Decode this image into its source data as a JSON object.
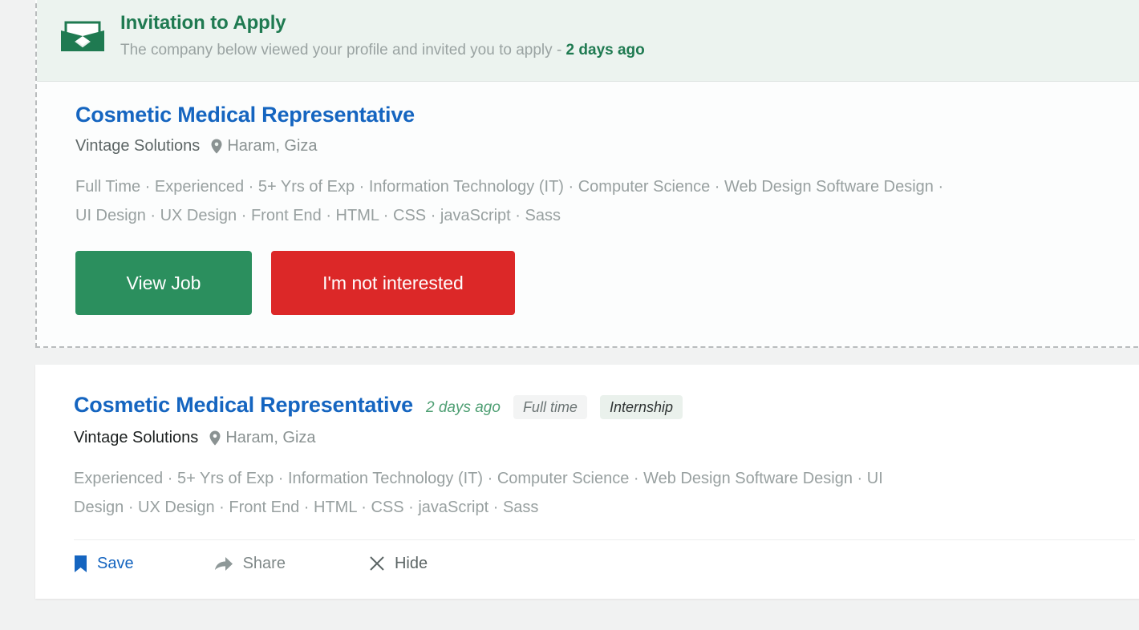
{
  "invitation_card": {
    "banner": {
      "icon": "open-envelope-icon",
      "title": "Invitation to Apply",
      "subtitle_text": "The company below viewed your profile and invited you to apply",
      "separator": "-",
      "time_ago": "2 days ago",
      "title_color": "#1f7a51",
      "background_color": "#ecf3ef"
    },
    "job": {
      "title": "Cosmetic Medical Representative",
      "company": "Vintage Solutions",
      "location_icon": "map-pin-icon",
      "location": "Haram, Giza",
      "tags": "Full Time · Experienced · 5+ Yrs of Exp · Information Technology (IT) · Computer Science · Web Design Software Design · UI Design · UX Design · Front End · HTML · CSS · javaScript · Sass"
    },
    "buttons": {
      "view_job": "View Job",
      "not_interested": "I'm not interested",
      "view_job_color": "#2b8f5e",
      "not_interested_color": "#dc2828"
    }
  },
  "job_card": {
    "title": "Cosmetic Medical Representative",
    "time_ago": "2 days ago",
    "badges": [
      {
        "label": "Full time",
        "type": "employment-type"
      },
      {
        "label": "Internship",
        "type": "experience-level"
      }
    ],
    "company": "Vintage Solutions",
    "location_icon": "map-pin-icon",
    "location": "Haram, Giza",
    "tags": "Experienced · 5+ Yrs of Exp · Information Technology (IT) · Computer Science · Web Design Software Design · UI Design · UX Design · Front End · HTML · CSS · javaScript · Sass",
    "actions": [
      {
        "label": "Save",
        "icon": "bookmark-icon",
        "color": "#1565c0"
      },
      {
        "label": "Share",
        "icon": "share-arrow-icon",
        "color": "#7f8888"
      },
      {
        "label": "Hide",
        "icon": "close-x-icon",
        "color": "#5c6565"
      }
    ]
  }
}
